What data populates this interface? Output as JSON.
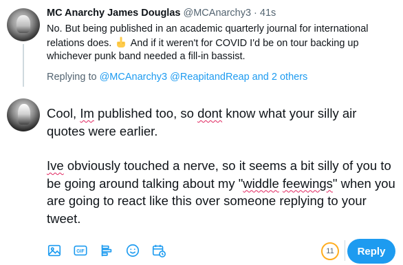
{
  "tweet": {
    "display_name": "MC Anarchy James Douglas",
    "handle": "@MCAnarchy3",
    "separator": " · ",
    "time": "41s",
    "text_part1": "No.  But being published in an academic quarterly journal for international relations does.",
    "emoji_icon": "middle-finger-emoji",
    "text_part2": "And if it weren't for COVID I'd be on tour backing up whichever punk band needed a fill-in bassist."
  },
  "replying": {
    "prefix": "Replying to ",
    "mention1": "@MCAnarchy3",
    "mention2": "@ReapitandReap",
    "and": " and ",
    "others": "2 others"
  },
  "draft": {
    "p1_a": "Cool, ",
    "p1_im": "Im",
    "p1_b": " published too, so ",
    "p1_dont": "dont",
    "p1_c": " know what your silly air quotes were earlier.",
    "p2_ive": "Ive",
    "p2_a": " obviously touched a nerve, so it seems a bit silly of you to be going around talking about my \"",
    "p2_widdle": "widdle",
    "p2_space": " ",
    "p2_feewings": "feewings",
    "p2_b": "\" when you are going to react like this over someone replying to your tweet."
  },
  "toolbar": {
    "icons": [
      "image-icon",
      "gif-icon",
      "poll-icon",
      "emoji-icon",
      "schedule-icon"
    ],
    "gif_label": "GIF",
    "char_remaining": "11",
    "reply_label": "Reply"
  },
  "colors": {
    "accent": "#1d9bf0",
    "secondary_text": "#536471",
    "counter_warning": "#ffad1f",
    "spellcheck": "#e0245e"
  }
}
